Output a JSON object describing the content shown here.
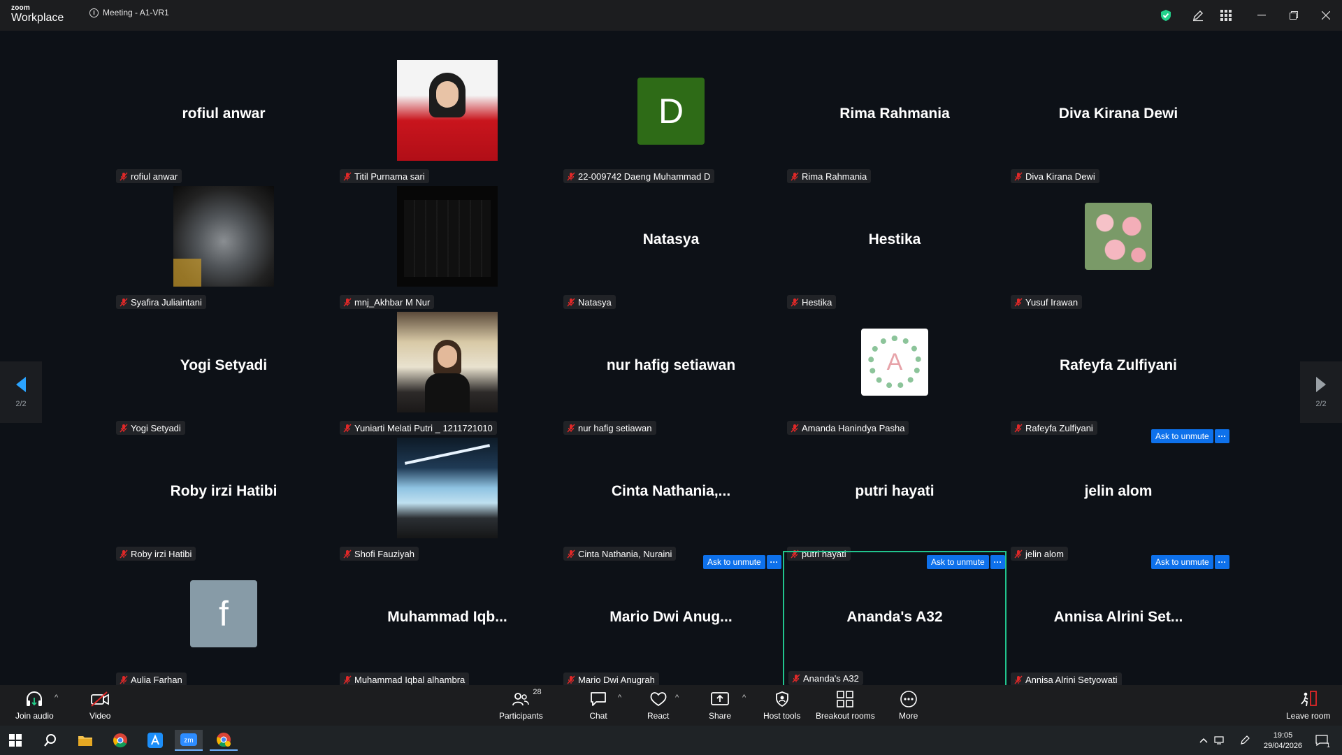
{
  "app": {
    "logo_top": "zoom",
    "logo_bottom": "Workplace",
    "meeting_title": "Meeting - A1-VR1"
  },
  "colors": {
    "accent": "#0e71eb",
    "active_speaker_border": "#21c48d",
    "muted_mic": "#e02828",
    "security_shield": "#23d18b"
  },
  "icons": [
    "security-shield-icon",
    "annotate-icon",
    "apps-grid-icon",
    "minimize-icon",
    "restore-icon",
    "close-icon"
  ],
  "pager": {
    "prev_page": "2/2",
    "next_page": "2/2"
  },
  "tiles": [
    {
      "big": "rofiul anwar",
      "label": "rofiul anwar"
    },
    {
      "big": "",
      "label": "Titil Purnama sari"
    },
    {
      "big": "",
      "label": "22-009742 Daeng Muhammad D",
      "avatar_letter": "D"
    },
    {
      "big": "Rima Rahmania",
      "label": "Rima Rahmania"
    },
    {
      "big": "Diva Kirana Dewi",
      "label": "Diva Kirana Dewi"
    },
    {
      "big": "",
      "label": "Syafira Juliaintani"
    },
    {
      "big": "",
      "label": "mnj_Akhbar M Nur"
    },
    {
      "big": "Natasya",
      "label": "Natasya"
    },
    {
      "big": "Hestika",
      "label": "Hestika"
    },
    {
      "big": "",
      "label": "Yusuf Irawan"
    },
    {
      "big": "Yogi Setyadi",
      "label": "Yogi Setyadi"
    },
    {
      "big": "",
      "label": "Yuniarti Melati Putri _ 1211721010"
    },
    {
      "big": "nur hafig setiawan",
      "label": "nur hafig setiawan"
    },
    {
      "big": "",
      "label": "Amanda Hanindya Pasha",
      "avatar_letter": "A"
    },
    {
      "big": "Rafeyfa Zulfiyani",
      "label": "Rafeyfa Zulfiyani"
    },
    {
      "big": "Roby irzi Hatibi",
      "label": "Roby irzi Hatibi"
    },
    {
      "big": "",
      "label": "Shofi Fauziyah"
    },
    {
      "big": "Cinta  Nathania,...",
      "label": "Cinta Nathania, Nuraini"
    },
    {
      "big": "putri hayati",
      "label": "putri hayati"
    },
    {
      "big": "jelin alom",
      "label": "jelin alom"
    },
    {
      "big": "",
      "label": "Aulia Farhan",
      "avatar_letter": "f"
    },
    {
      "big": "Muhammad  Iqb...",
      "label": "Muhammad Iqbal alhambra"
    },
    {
      "big": "Mario  Dwi  Anug...",
      "label": "Mario Dwi Anugrah"
    },
    {
      "big": "Ananda's A32",
      "label": "Ananda's A32"
    },
    {
      "big": "Annisa  Alrini  Set...",
      "label": "Annisa Alrini Setyowati"
    }
  ],
  "ask_unmute": {
    "label": "Ask to unmute",
    "more": "···"
  },
  "toolbar": {
    "join_audio": "Join audio",
    "video": "Video",
    "participants": "Participants",
    "participants_count": "28",
    "chat": "Chat",
    "react": "React",
    "share": "Share",
    "host_tools": "Host tools",
    "breakout_rooms": "Breakout rooms",
    "more": "More",
    "leave_room": "Leave room"
  },
  "taskbar": {
    "time": "19:05",
    "date": "29/04/2026",
    "notifications": "1"
  }
}
